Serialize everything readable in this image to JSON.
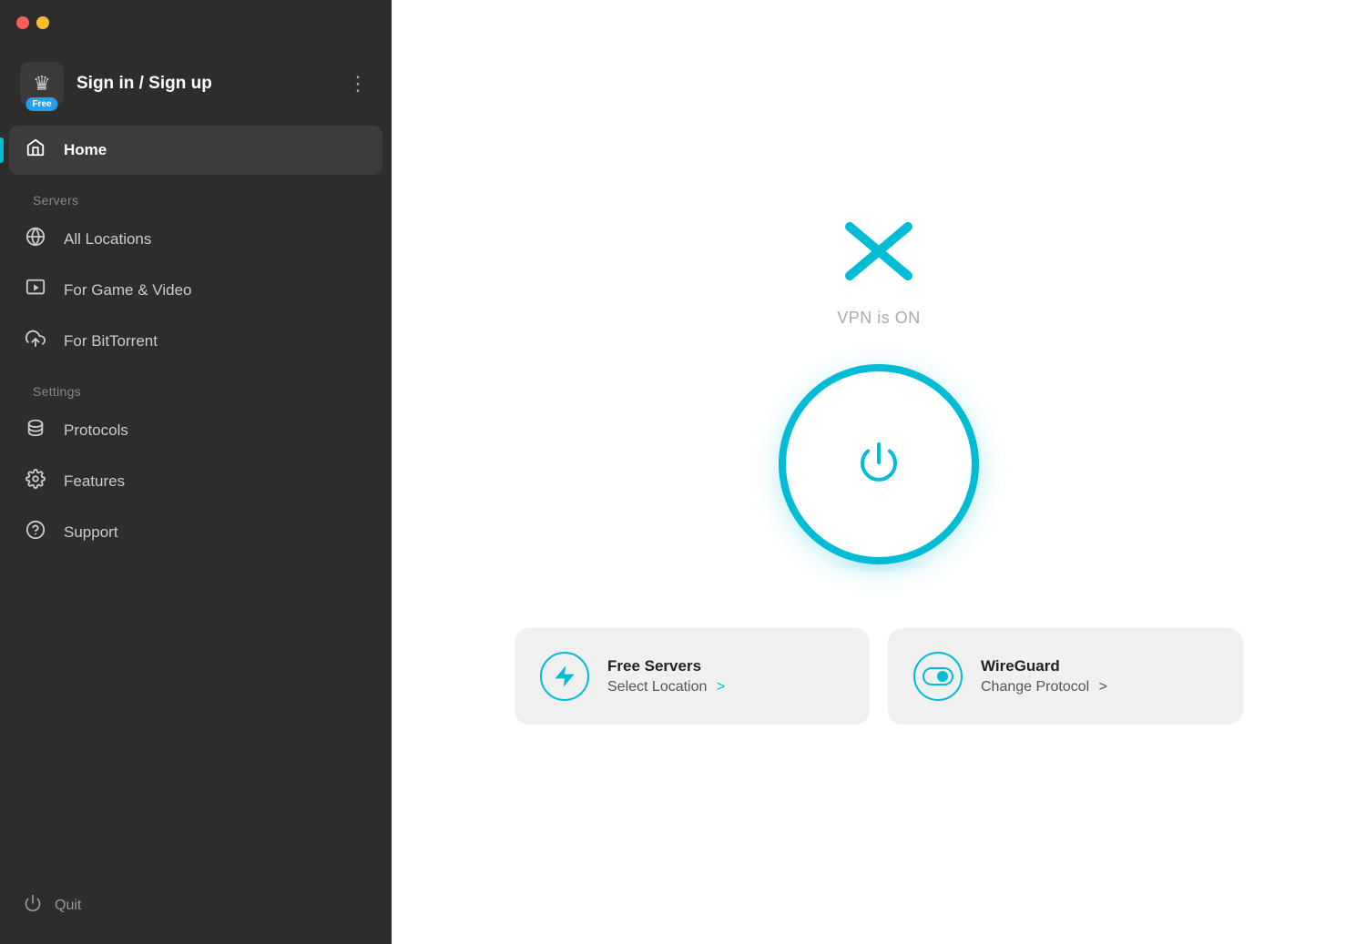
{
  "titleBar": {
    "trafficClose": "close",
    "trafficMinimize": "minimize"
  },
  "sidebar": {
    "user": {
      "name": "Sign in / Sign up",
      "badge": "Free",
      "moreIcon": "⋮"
    },
    "serversLabel": "Servers",
    "settingsLabel": "Settings",
    "navItems": [
      {
        "id": "home",
        "label": "Home",
        "icon": "🏠",
        "active": true
      },
      {
        "id": "all-locations",
        "label": "All Locations",
        "icon": "🌐",
        "active": false
      },
      {
        "id": "game-video",
        "label": "For Game & Video",
        "icon": "▶",
        "active": false
      },
      {
        "id": "bittorrent",
        "label": "For BitTorrent",
        "icon": "☁",
        "active": false
      },
      {
        "id": "protocols",
        "label": "Protocols",
        "icon": "⧖",
        "active": false
      },
      {
        "id": "features",
        "label": "Features",
        "icon": "⚙",
        "active": false
      },
      {
        "id": "support",
        "label": "Support",
        "icon": "?",
        "active": false
      }
    ],
    "quit": {
      "label": "Quit",
      "icon": "power"
    }
  },
  "main": {
    "vpnStatus": "VPN is ON",
    "bottomCards": [
      {
        "id": "free-servers",
        "title": "Free Servers",
        "subtitle": "Select Location",
        "arrow": ">"
      },
      {
        "id": "wireguard",
        "title": "WireGuard",
        "subtitle": "Change Protocol",
        "arrow": ">"
      }
    ]
  }
}
